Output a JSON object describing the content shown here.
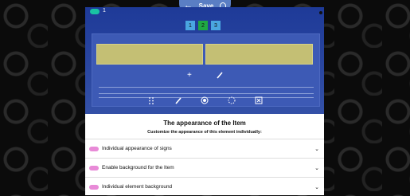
{
  "header": {
    "back_icon": "arrow-left-icon",
    "save_label": "Save",
    "hint_icon": "lightbulb-icon"
  },
  "editor": {
    "toggle_value": "1",
    "tabs": [
      "1",
      "2",
      "3"
    ],
    "active_tab": "2",
    "tools": [
      "plus-icon",
      "brush-icon"
    ],
    "bottom_tools": [
      "drag-icon",
      "pencil-icon",
      "target-icon",
      "dashed-circle-icon",
      "delete-box-icon"
    ]
  },
  "sheet": {
    "title": "The appearance of the Item",
    "subtitle": "Customize the appearance of this element individually:",
    "rows": [
      {
        "label": "Individual appearance of signs"
      },
      {
        "label": "Enable background for the Item"
      },
      {
        "label": "Individual element background"
      }
    ]
  },
  "colors": {
    "accent": "#5a7ec4",
    "field": "#c4bf74",
    "toggle": "#e88ad7",
    "active_tab": "#1fa843"
  }
}
